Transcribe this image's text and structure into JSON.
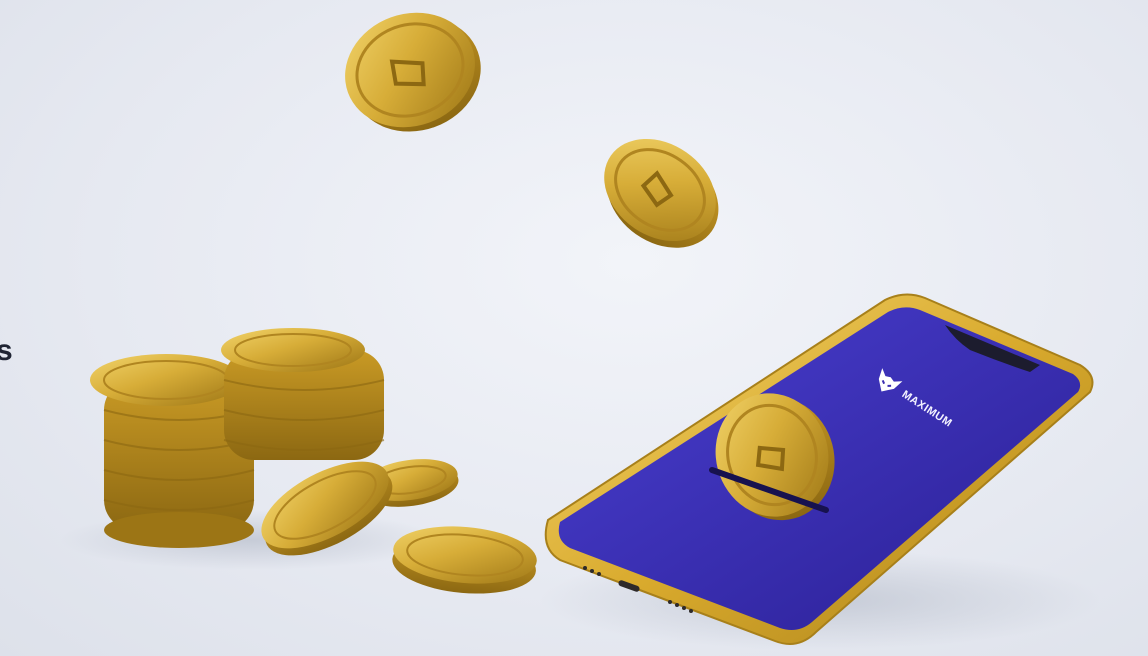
{
  "edge_text": "s",
  "phone": {
    "brand_name": "MAXIMUM",
    "logo_icon": "fox-head-icon",
    "screen_color": "#3a2db0",
    "frame_color": "#d7aa2c"
  },
  "colors": {
    "background": "#e9ecf3",
    "coin_gold": "#d8b13a",
    "coin_dark": "#a8801c"
  }
}
